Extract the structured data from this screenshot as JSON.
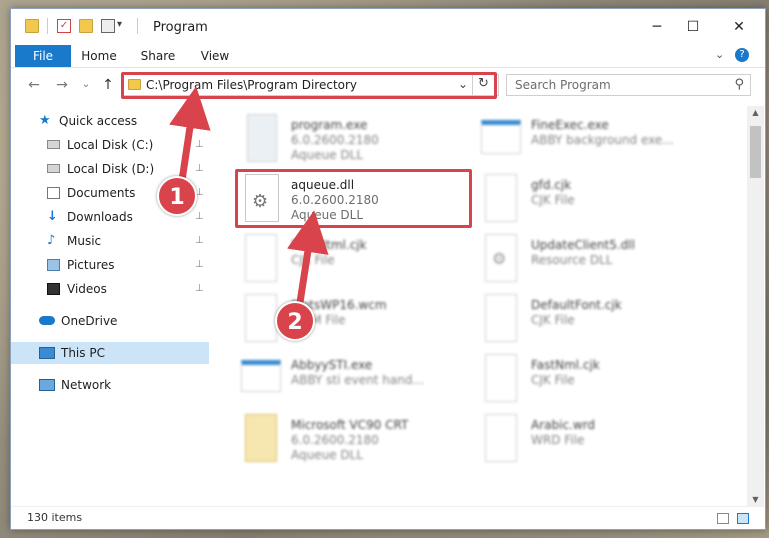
{
  "window": {
    "title": "Program",
    "controls": {
      "minimize": "─",
      "maximize": "☐",
      "close": "✕"
    }
  },
  "ribbon": {
    "tabs": [
      {
        "label": "File"
      },
      {
        "label": "Home"
      },
      {
        "label": "Share"
      },
      {
        "label": "View"
      }
    ],
    "help_glyph": "?",
    "expand_glyph": "⌄"
  },
  "address_bar": {
    "path": "C:\\Program Files\\Program Directory",
    "dropdown_glyph": "⌄",
    "refresh_glyph": "↻"
  },
  "nav_buttons": {
    "back": "←",
    "forward": "→",
    "recent": "⌄",
    "up": "↑"
  },
  "search": {
    "placeholder": "Search Program",
    "icon": "search-icon"
  },
  "nav_pane": {
    "items": [
      {
        "label": "Quick access",
        "icon": "star-icon",
        "pinned": false
      },
      {
        "label": "Local Disk (C:)",
        "icon": "drive-icon",
        "pinned": true
      },
      {
        "label": "Local Disk (D:)",
        "icon": "drive-icon",
        "pinned": true
      },
      {
        "label": "Documents",
        "icon": "documents-icon",
        "pinned": true
      },
      {
        "label": "Downloads",
        "icon": "downloads-icon",
        "pinned": true
      },
      {
        "label": "Music",
        "icon": "music-icon",
        "pinned": true
      },
      {
        "label": "Pictures",
        "icon": "pictures-icon",
        "pinned": true
      },
      {
        "label": "Videos",
        "icon": "videos-icon",
        "pinned": true
      },
      {
        "label": "OneDrive",
        "icon": "cloud-icon",
        "pinned": false
      },
      {
        "label": "This PC",
        "icon": "computer-icon",
        "pinned": false,
        "selected": true
      },
      {
        "label": "Network",
        "icon": "network-icon",
        "pinned": false
      }
    ],
    "pin_glyph": "📌"
  },
  "files": [
    {
      "name": "program.exe",
      "line2": "6.0.2600.2180",
      "line3": "Aqueue DLL",
      "icon": "exe-icon",
      "blurred": true
    },
    {
      "name": "FineExec.exe",
      "line2": "ABBY background exe...",
      "line3": "",
      "icon": "window-icon",
      "blurred": true
    },
    {
      "name": "aqueue.dll",
      "line2": "6.0.2600.2180",
      "line3": "Aqueue DLL",
      "icon": "dll-gear-icon",
      "blurred": false
    },
    {
      "name": "gfd.cjk",
      "line2": "CJK File",
      "line3": "",
      "icon": "document-icon",
      "blurred": true
    },
    {
      "name": "FontHtml.cjk",
      "line2": "CJK File",
      "line3": "",
      "icon": "document-icon",
      "blurred": true
    },
    {
      "name": "UpdateClient5.dll",
      "line2": "Resource DLL",
      "line3": "",
      "icon": "dll-gear-icon",
      "blurred": true
    },
    {
      "name": "SlotsWP16.wcm",
      "line2": "WCM File",
      "line3": "",
      "icon": "document-icon",
      "blurred": true
    },
    {
      "name": "DefaultFont.cjk",
      "line2": "CJK File",
      "line3": "",
      "icon": "document-icon",
      "blurred": true
    },
    {
      "name": "AbbyySTI.exe",
      "line2": "ABBY sti event hand...",
      "line3": "",
      "icon": "window-icon",
      "blurred": true
    },
    {
      "name": "FastNml.cjk",
      "line2": "CJK File",
      "line3": "",
      "icon": "document-icon",
      "blurred": true
    },
    {
      "name": "Microsoft VC90 CRT",
      "line2": "6.0.2600.2180",
      "line3": "Aqueue DLL",
      "icon": "folder-doc-icon",
      "blurred": true
    },
    {
      "name": "Arabic.wrd",
      "line2": "WRD File",
      "line3": "",
      "icon": "document-icon",
      "blurred": true
    }
  ],
  "status_bar": {
    "item_count": "130 items"
  },
  "annotations": {
    "step1": "1",
    "step2": "2",
    "color": "#d9434b"
  },
  "colors": {
    "file_tab": "#1979ca",
    "selection": "#cce4f7",
    "annotation": "#d9434b"
  }
}
